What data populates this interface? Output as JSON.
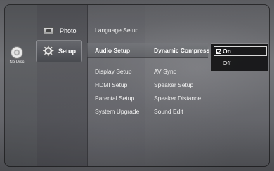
{
  "disc": {
    "label": "No Disc",
    "icon": "disc-icon"
  },
  "main_menu": [
    {
      "label": "Photo",
      "icon": "photo-icon"
    },
    {
      "label": "Setup",
      "icon": "gear-icon",
      "selected": true
    }
  ],
  "submenu": [
    {
      "label": "Language Setup"
    },
    {
      "label": "Audio Setup",
      "selected": true
    },
    {
      "label": "Display Setup"
    },
    {
      "label": "HDMI Setup"
    },
    {
      "label": "Parental Setup"
    },
    {
      "label": "System Upgrade"
    }
  ],
  "options": [
    {
      "label": "Dynamic Compression",
      "selected": true
    },
    {
      "label": "AV Sync"
    },
    {
      "label": "Speaker Setup"
    },
    {
      "label": "Speaker Distance"
    },
    {
      "label": "Sound Edit"
    }
  ],
  "popup": {
    "items": [
      {
        "label": "On",
        "checked": true
      },
      {
        "label": "Off"
      }
    ]
  }
}
